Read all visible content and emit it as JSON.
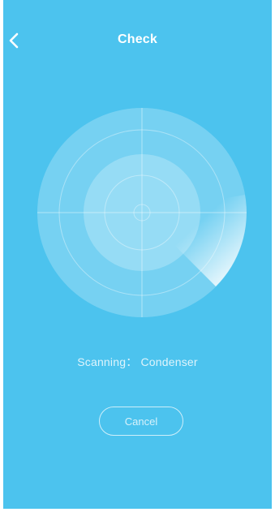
{
  "header": {
    "title": "Check",
    "back_icon": "chevron-left-icon"
  },
  "scan": {
    "status_text": "Scanning： Condenser"
  },
  "actions": {
    "cancel_label": "Cancel"
  },
  "colors": {
    "background": "#4cc3ee",
    "accent": "#ffffff"
  }
}
